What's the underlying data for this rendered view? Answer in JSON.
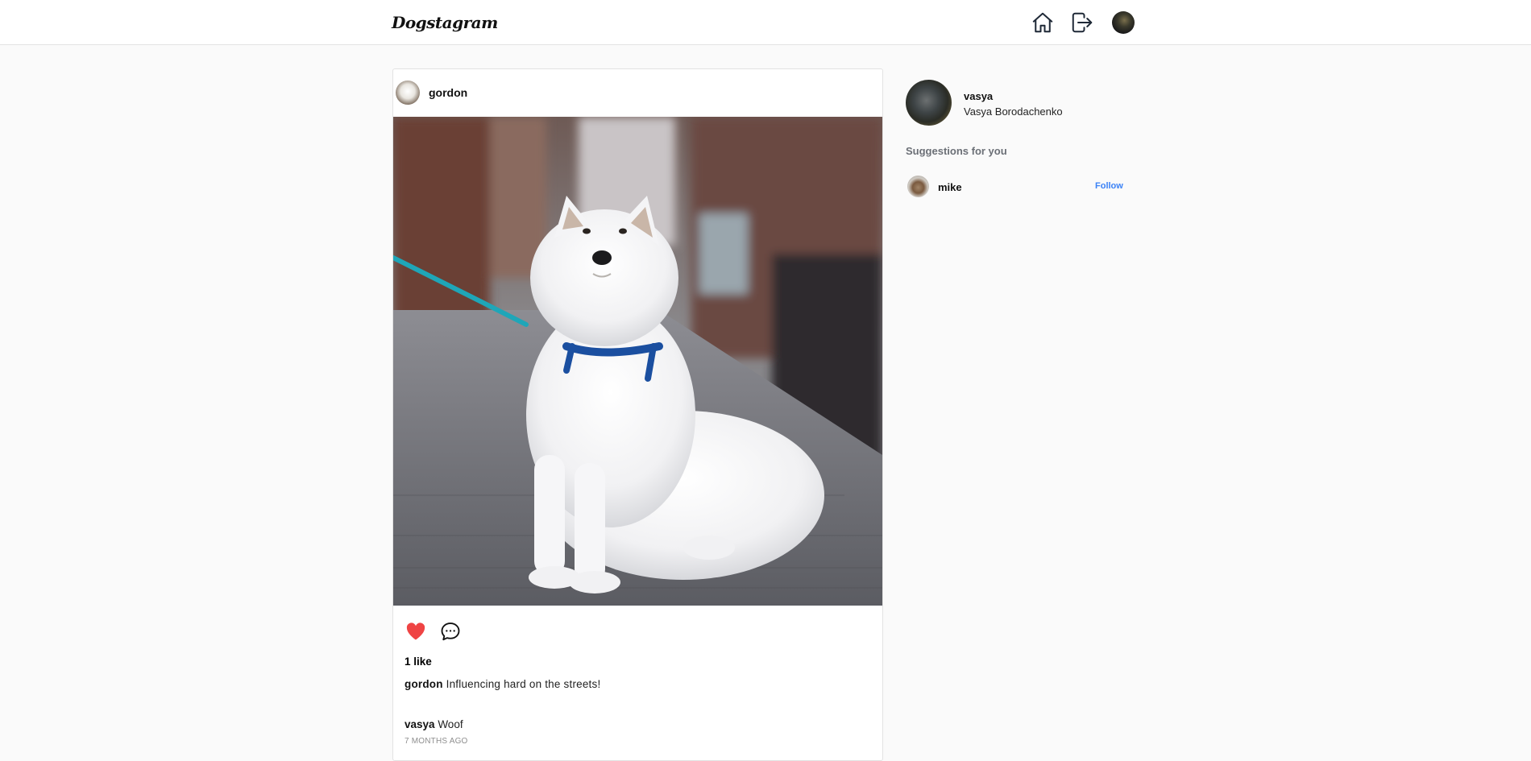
{
  "app": {
    "logo": "Dogstagram"
  },
  "nav": {
    "home_icon": "home-icon",
    "logout_icon": "logout-icon",
    "avatar": "user-avatar"
  },
  "post": {
    "username": "gordon",
    "likes": "1 like",
    "caption": {
      "username": "gordon",
      "text": "Influencing hard on the streets!"
    },
    "comments": [
      {
        "username": "vasya",
        "text": "Woof"
      }
    ],
    "timestamp": "7 MONTHS AGO",
    "liked_color": "#ef4444"
  },
  "sidebar": {
    "profile": {
      "username": "vasya",
      "full_name": "Vasya Borodachenko"
    },
    "suggestions_title": "Suggestions for you",
    "suggestions": [
      {
        "username": "mike",
        "action": "Follow"
      }
    ],
    "follow_color": "#3b82f6"
  }
}
